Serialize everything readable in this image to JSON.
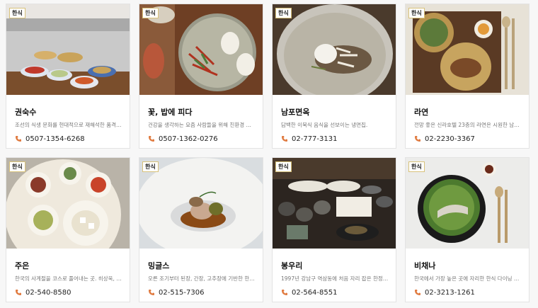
{
  "colors": {
    "accent": "#e07a3f",
    "badge_border": "#d8c27a",
    "muted": "#777777"
  },
  "cards": [
    {
      "badge": "한식",
      "name": "권숙수",
      "desc": "조선의 식생 문화를 현대적으로 재해석한 품격 높...",
      "phone": "0507-1354-6268",
      "image": "banchan-dishes-photo"
    },
    {
      "badge": "한식",
      "name": "꽃, 밥에 피다",
      "desc": "건강을 생각하는 요즘 사람들을 위해 친환경 유기...",
      "phone": "0507-1362-0276",
      "image": "bossam-buns-photo"
    },
    {
      "badge": "한식",
      "name": "남포면옥",
      "desc": "담백한 이북식 음식을 선보이는 냉면집.",
      "phone": "02-777-3131",
      "image": "naengmyeon-bowl-photo"
    },
    {
      "badge": "한식",
      "name": "라연",
      "desc": "전망 좋은 신라호텔 23층의 라연은 시원한 남산 ...",
      "phone": "02-2230-3367",
      "image": "brass-tray-photo"
    },
    {
      "badge": "한식",
      "name": "주은",
      "desc": "한국의 사계절을 코스로 풀어내는 곳. 히상욱, 장...",
      "phone": "02-540-8580",
      "image": "white-plates-photo"
    },
    {
      "badge": "한식",
      "name": "밍글스",
      "desc": "오른 조기부터 된장, 간장, 고추장에 기반한 한국...",
      "phone": "02-515-7306",
      "image": "plated-dish-photo"
    },
    {
      "badge": "한식",
      "name": "봉우리",
      "desc": "1997년 강남구 역삼동에 처음 자리 잡은 한정식당.",
      "phone": "02-564-8551",
      "image": "dark-table-photo"
    },
    {
      "badge": "한식",
      "name": "비채나",
      "desc": "한국에서 가장 높은 곳에 자리한 한식 다이닝 레스...",
      "phone": "02-3213-1261",
      "image": "pot-rice-photo"
    }
  ]
}
